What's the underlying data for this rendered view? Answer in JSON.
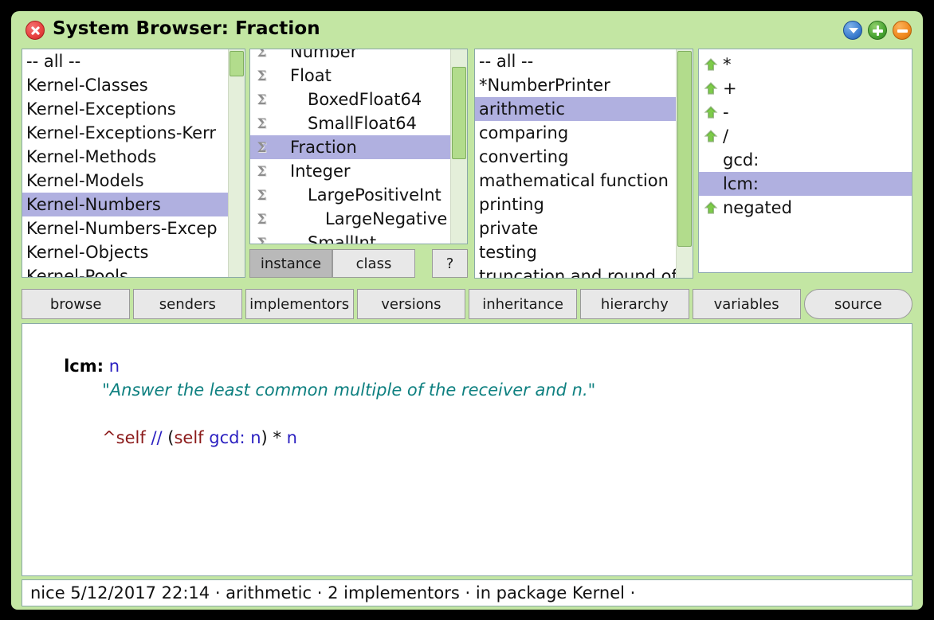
{
  "window": {
    "title": "System Browser: Fraction",
    "close_icon": "close-icon",
    "menu_icon": "window-menu-icon",
    "expand_icon": "expand-icon",
    "collapse_icon": "collapse-icon"
  },
  "packages": {
    "items": [
      {
        "label": "-- all --",
        "selected": false
      },
      {
        "label": "Kernel-Classes",
        "selected": false
      },
      {
        "label": "Kernel-Exceptions",
        "selected": false
      },
      {
        "label": "Kernel-Exceptions-Kerr",
        "selected": false
      },
      {
        "label": "Kernel-Methods",
        "selected": false
      },
      {
        "label": "Kernel-Models",
        "selected": false
      },
      {
        "label": "Kernel-Numbers",
        "selected": true
      },
      {
        "label": "Kernel-Numbers-Excep",
        "selected": false
      },
      {
        "label": "Kernel-Objects",
        "selected": false
      },
      {
        "label": "Kernel-Pools",
        "selected": false
      }
    ]
  },
  "classes": {
    "items": [
      {
        "label": "Number",
        "indent": 1,
        "icon": "class-icon",
        "selected": false
      },
      {
        "label": "Float",
        "indent": 1,
        "icon": "class-icon",
        "selected": false
      },
      {
        "label": "BoxedFloat64",
        "indent": 2,
        "icon": "class-icon",
        "selected": false
      },
      {
        "label": "SmallFloat64",
        "indent": 2,
        "icon": "class-icon",
        "selected": false
      },
      {
        "label": "Fraction",
        "indent": 1,
        "icon": "class-icon",
        "selected": true
      },
      {
        "label": "Integer",
        "indent": 1,
        "icon": "class-icon",
        "selected": false
      },
      {
        "label": "LargePositiveInt",
        "indent": 2,
        "icon": "class-icon",
        "selected": false
      },
      {
        "label": "LargeNegative",
        "indent": 3,
        "icon": "class-icon",
        "selected": false
      },
      {
        "label": "SmallInt",
        "indent": 2,
        "icon": "class-icon",
        "selected": false
      }
    ],
    "side_buttons": {
      "instance": "instance",
      "class": "class",
      "help": "?"
    },
    "side_selected": "instance"
  },
  "protocols": {
    "items": [
      {
        "label": "-- all --",
        "selected": false
      },
      {
        "label": "*NumberPrinter",
        "selected": false
      },
      {
        "label": "arithmetic",
        "selected": true
      },
      {
        "label": "comparing",
        "selected": false
      },
      {
        "label": "converting",
        "selected": false
      },
      {
        "label": "mathematical function",
        "selected": false
      },
      {
        "label": "printing",
        "selected": false
      },
      {
        "label": "private",
        "selected": false
      },
      {
        "label": "testing",
        "selected": false
      },
      {
        "label": "truncation and round off",
        "selected": false
      }
    ]
  },
  "methods": {
    "items": [
      {
        "label": "*",
        "icon": "override-arrow-icon",
        "has_icon": true,
        "selected": false
      },
      {
        "label": "+",
        "icon": "override-arrow-icon",
        "has_icon": true,
        "selected": false
      },
      {
        "label": "-",
        "icon": "override-arrow-icon",
        "has_icon": true,
        "selected": false
      },
      {
        "label": "/",
        "icon": "override-arrow-icon",
        "has_icon": true,
        "selected": false
      },
      {
        "label": "gcd:",
        "icon": "",
        "has_icon": false,
        "selected": false
      },
      {
        "label": "lcm:",
        "icon": "",
        "has_icon": false,
        "selected": true
      },
      {
        "label": "negated",
        "icon": "override-arrow-icon",
        "has_icon": true,
        "selected": false
      }
    ]
  },
  "toolbar": {
    "buttons": [
      {
        "label": "browse",
        "active": false
      },
      {
        "label": "senders",
        "active": false
      },
      {
        "label": "implementors",
        "active": false
      },
      {
        "label": "versions",
        "active": false
      },
      {
        "label": "inheritance",
        "active": false
      },
      {
        "label": "hierarchy",
        "active": false
      },
      {
        "label": "variables",
        "active": false
      },
      {
        "label": "source",
        "active": true
      }
    ]
  },
  "source": {
    "selector": "lcm:",
    "argument": "n",
    "comment": "\"Answer the least common multiple of the receiver and n.\"",
    "body": {
      "caret_self": "^self",
      "slash_slash": "//",
      "paren_open": "(",
      "self2": "self",
      "gcd_msg": "gcd:",
      "arg_n1": "n",
      "paren_close": ")",
      "star": "*",
      "arg_n2": "n"
    }
  },
  "status": {
    "text": "nice 5/12/2017 22:14 · arithmetic · 2 implementors · in package Kernel ·"
  },
  "colors": {
    "window_bg": "#c3e6a3",
    "selection": "#b0b0e0",
    "comment": "#0e8080",
    "keyword": "#8b1a1a",
    "variable": "#2a1fc0"
  }
}
